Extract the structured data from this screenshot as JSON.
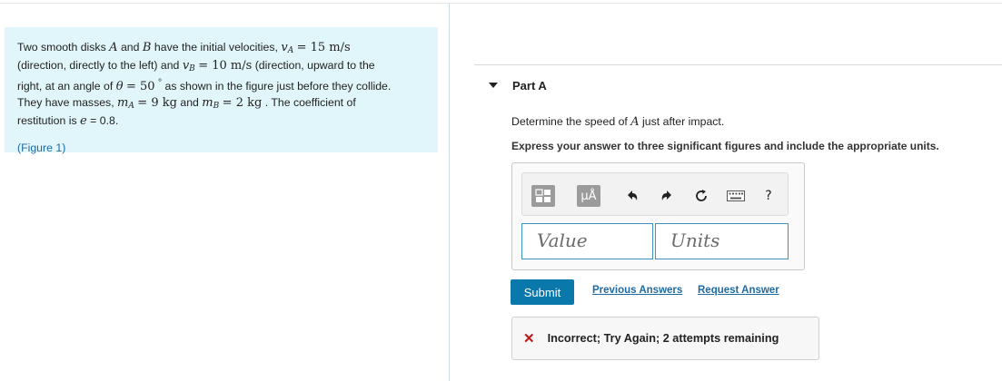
{
  "problem": {
    "figure_link": "(Figure 1)"
  },
  "part": {
    "title": "Part A",
    "question_prefix": "Determine the speed of ",
    "question_var": "A",
    "question_suffix": " just after impact.",
    "instruction": "Express your answer to three significant figures and include the appropriate units."
  },
  "toolbar": {
    "units_symbol": "μÅ",
    "help_label": "?"
  },
  "inputs": {
    "value_placeholder": "Value",
    "units_placeholder": "Units"
  },
  "actions": {
    "submit_label": "Submit",
    "previous_answers": "Previous Answers",
    "request_answer": "Request Answer"
  },
  "feedback": {
    "text": "Incorrect; Try Again; 2 attempts remaining"
  }
}
